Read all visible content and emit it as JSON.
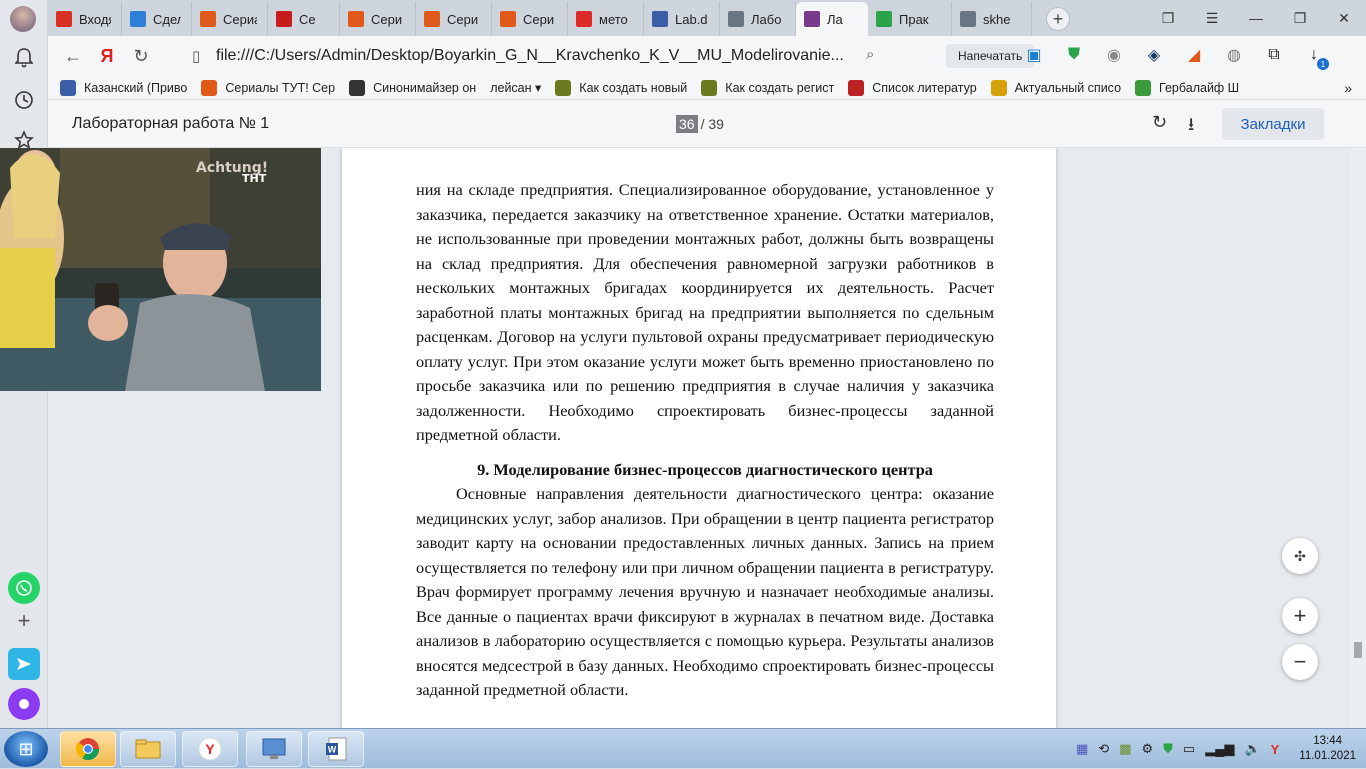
{
  "browser": {
    "tabs": [
      {
        "icon": "mail-icon",
        "color": "#d93025",
        "label": "Входя"
      },
      {
        "icon": "deal-icon",
        "color": "#2f7fd9",
        "label": "Сдел"
      },
      {
        "icon": "kinopoisk-icon",
        "color": "#e05a1c",
        "label": "Сериа"
      },
      {
        "icon": "bookmark-red-icon",
        "color": "#c61c1c",
        "label": "Се"
      },
      {
        "icon": "kinopoisk-icon",
        "color": "#e05a1c",
        "label": "Сери"
      },
      {
        "icon": "kinopoisk-icon",
        "color": "#e05a1c",
        "label": "Сери"
      },
      {
        "icon": "kinopoisk-icon",
        "color": "#e05a1c",
        "label": "Сери"
      },
      {
        "icon": "yandex-icon",
        "color": "#e02a2a",
        "label": "мето"
      },
      {
        "icon": "doc-icon",
        "color": "#3a5fa8",
        "label": "Lab.d"
      },
      {
        "icon": "globe-icon",
        "color": "#6b7685",
        "label": "Лабо"
      },
      {
        "icon": "pdf-icon",
        "color": "#7a3a8c",
        "label": "Ла"
      },
      {
        "icon": "check-icon",
        "color": "#2aa34a",
        "label": "Прак"
      },
      {
        "icon": "file-icon",
        "color": "#6b7685",
        "label": "skhe"
      }
    ],
    "active_tab_index": 10,
    "url": "file:///C:/Users/Admin/Desktop/Boyarkin_G_N__Kravchenko_K_V__MU_Modelirovanie...",
    "print_label": "Напечатать",
    "bookmarks": [
      {
        "icon": "museum-icon",
        "label": "Казанский (Приво"
      },
      {
        "icon": "kinopoisk-icon",
        "label": "Сериалы ТУТ! Сер"
      },
      {
        "icon": "star-icon",
        "label": "Синонимайзер он"
      },
      {
        "icon": "",
        "label": "лейсан ▾"
      },
      {
        "icon": "s-icon",
        "label": "Как создать новый"
      },
      {
        "icon": "s-icon",
        "label": "Как создать регист"
      },
      {
        "icon": "book-icon",
        "label": "Список литератур"
      },
      {
        "icon": "c-icon",
        "label": "Актуальный списо"
      },
      {
        "icon": "herbalife-icon",
        "label": "Гербалайф Ш"
      }
    ]
  },
  "viewer": {
    "doc_title": "Лабораторная работа № 1",
    "page_current": "36",
    "page_total": "/ 39",
    "bookmarks_button": "Закладки"
  },
  "page": {
    "para1": "ния на складе предприятия. Специализированное оборудование, установленное у заказчика, передается заказчику на ответственное хранение. Остатки материалов, не использованные при проведении монтажных работ, должны быть возвращены на склад предприятия. Для обеспечения равномерной загрузки работников в нескольких монтажных бригадах координируется их деятельность. Расчет заработной платы монтажных бригад на предприятии выполняется по сдельным расценкам. Договор на услуги пультовой охраны предусматривает периодическую оплату услуг. При этом оказание услуги может быть временно приостановлено по просьбе заказчика или по решению предприятия в случае наличия у заказчика задолженности. Необходимо спроектировать бизнес-процессы заданной предметной области.",
    "heading": "9. Моделирование бизнес-процессов диагностического центра",
    "para2": "Основные направления деятельности диагностического центра: оказание медицинских услуг, забор анализов. При обращении в центр пациента регистратор заводит карту на основании предоставленных личных данных. Запись на прием осуществляется по телефону или при личном обращении пациента в регистратуру. Врач формирует программу лечения вручную и назначает необходимые анализы. Все данные о пациентах врачи фиксируют в журналах в печатном виде. Доставка анализов в лабораторию осуществляется с помощью курьера. Результаты анализов вносятся медсестрой в базу данных. Необходимо спроектировать бизнес-процессы заданной предметной области."
  },
  "video": {
    "sign": "Achtung!",
    "channel": "ТНТ"
  },
  "taskbar": {
    "time": "13:44",
    "date": "11.01.2021"
  },
  "notification_badge": "1"
}
